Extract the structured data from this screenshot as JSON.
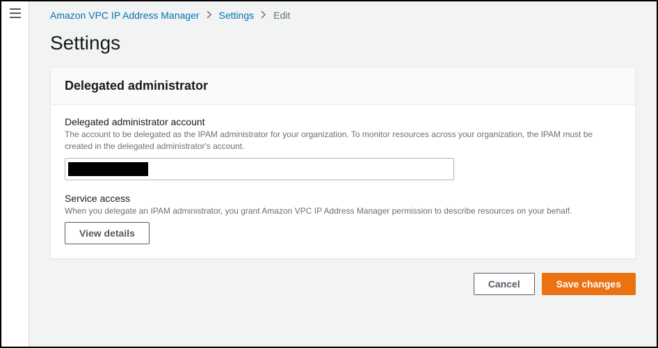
{
  "breadcrumb": {
    "root": "Amazon VPC IP Address Manager",
    "settings": "Settings",
    "current": "Edit"
  },
  "page": {
    "title": "Settings"
  },
  "panel": {
    "header": "Delegated administrator",
    "account": {
      "label": "Delegated administrator account",
      "description": "The account to be delegated as the IPAM administrator for your organization. To monitor resources across your organization, the IPAM must be created in the delegated administrator's account.",
      "value_redacted": true
    },
    "service_access": {
      "label": "Service access",
      "description": "When you delegate an IPAM administrator, you grant Amazon VPC IP Address Manager permission to describe resources on your behalf.",
      "view_details_label": "View details"
    }
  },
  "actions": {
    "cancel": "Cancel",
    "save": "Save changes"
  }
}
